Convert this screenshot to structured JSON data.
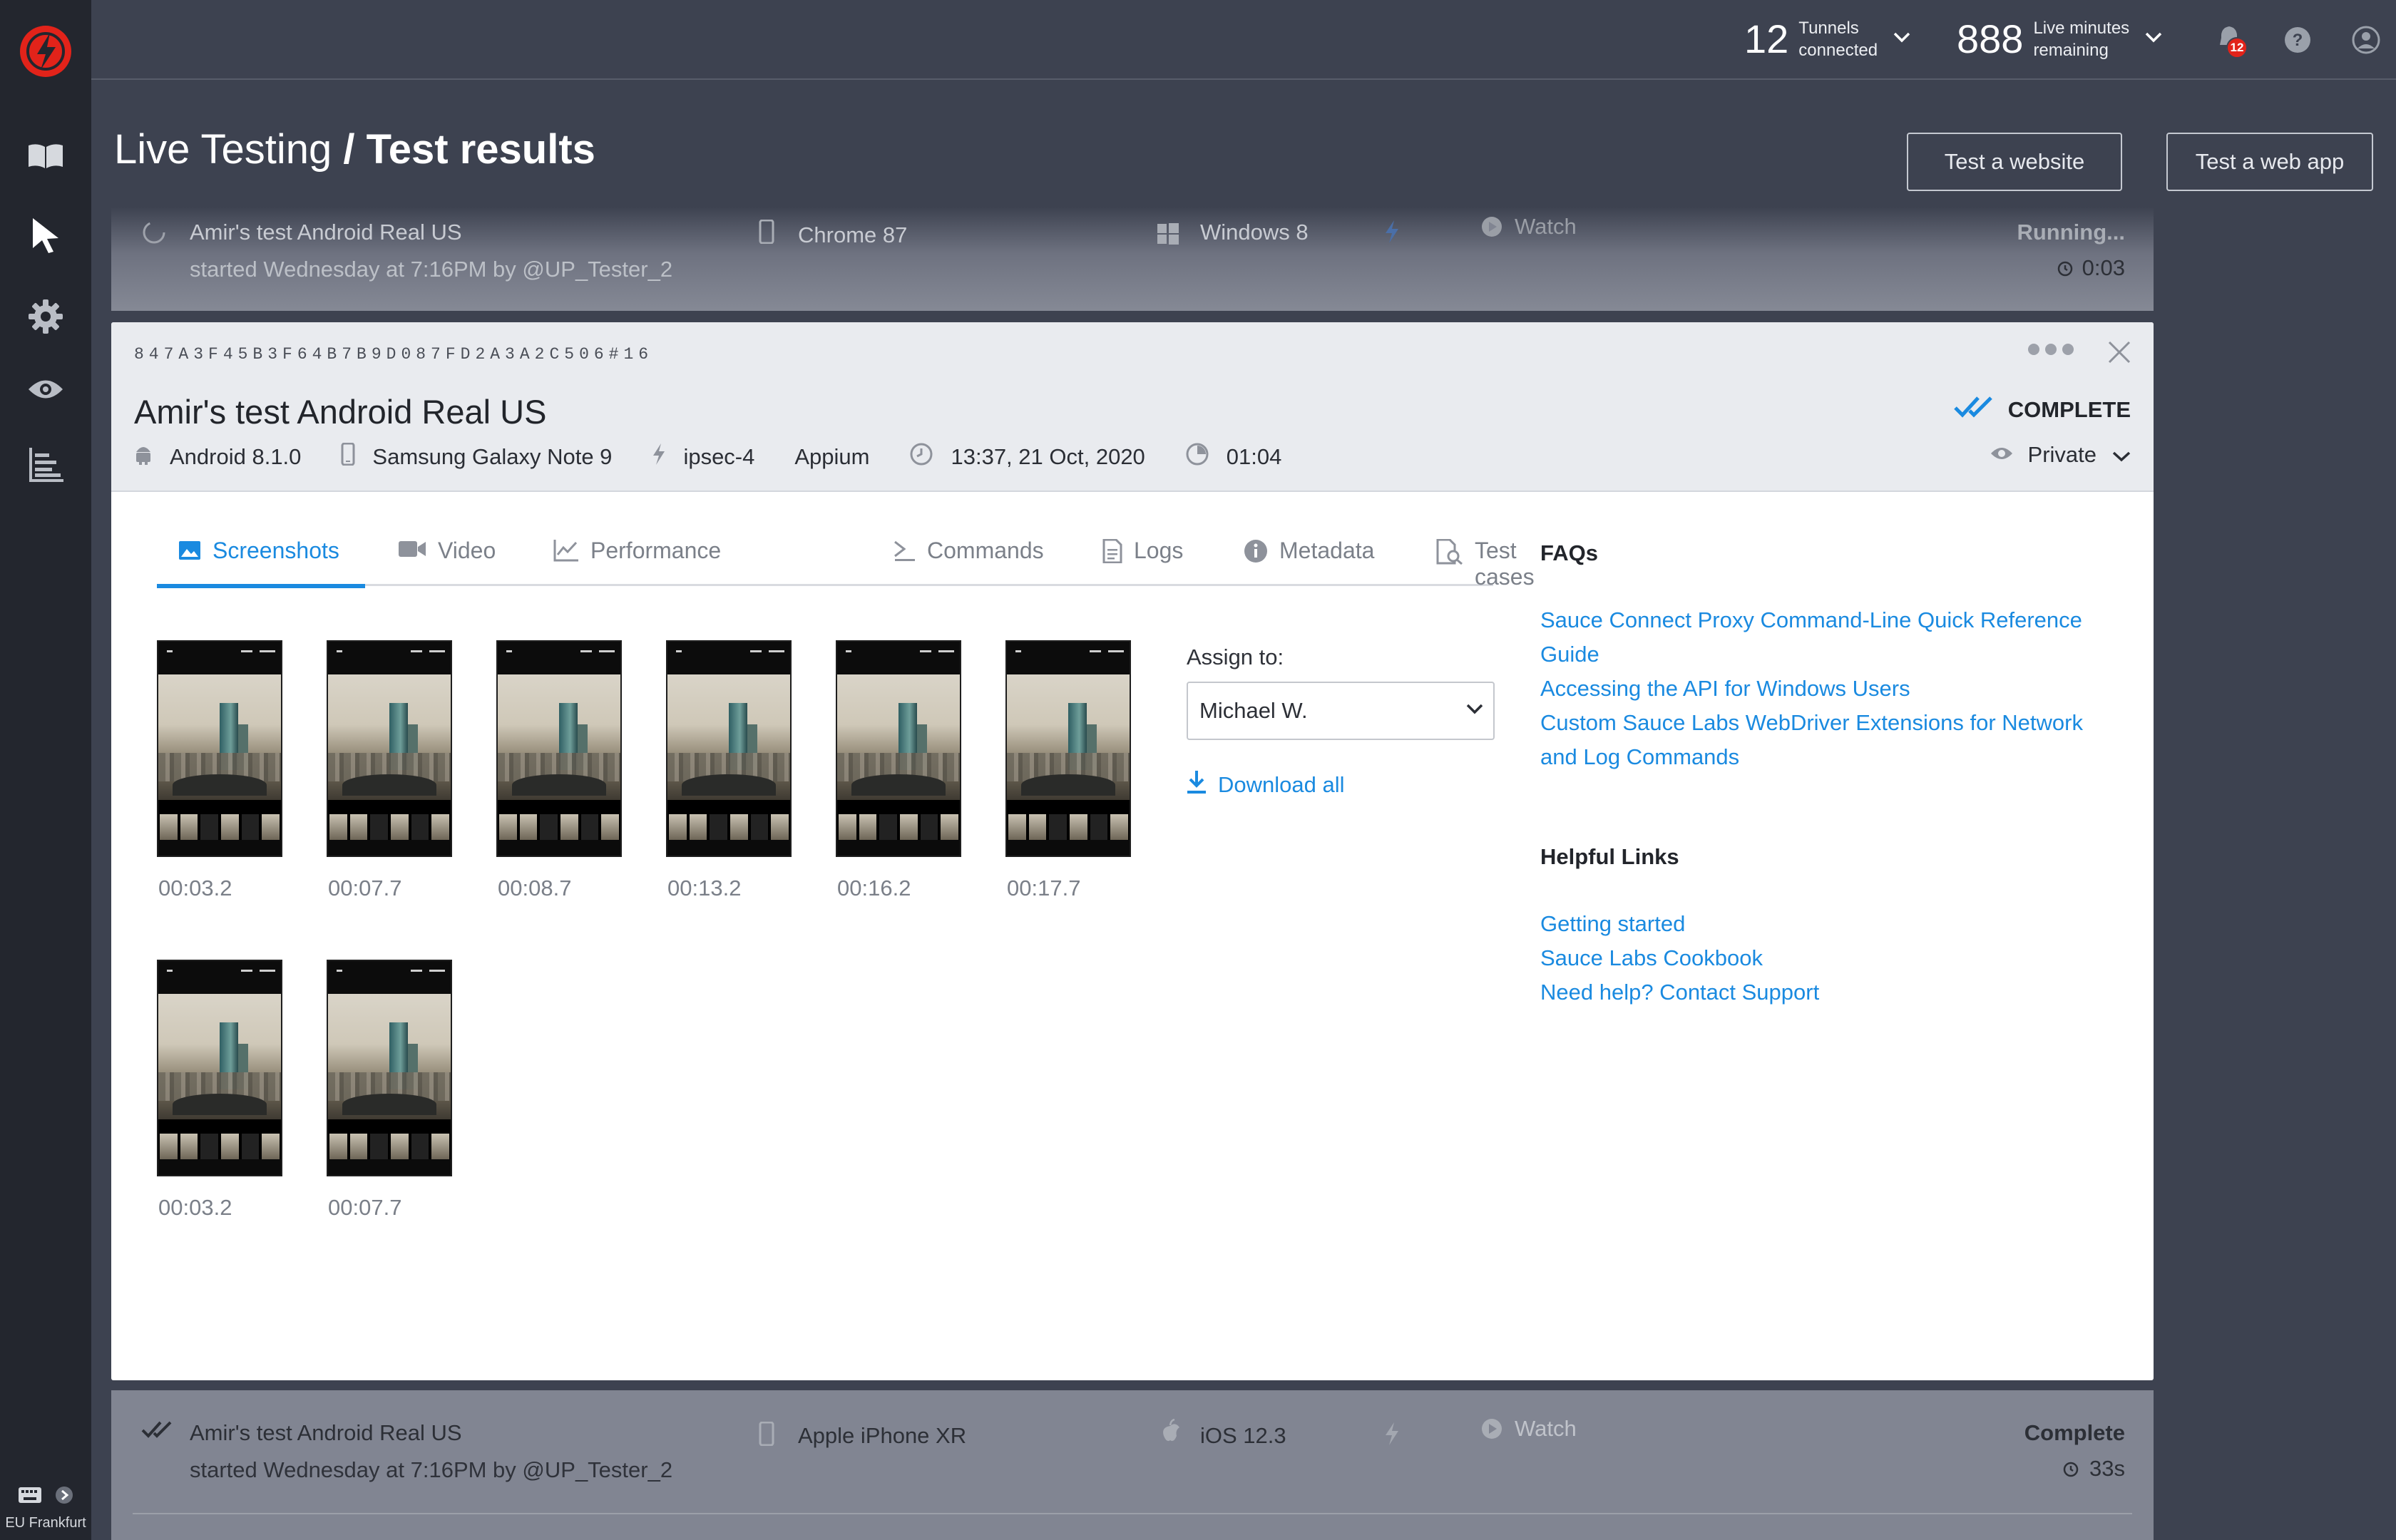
{
  "sidebar": {
    "location": "EU Frankfurt"
  },
  "topbar": {
    "tunnels": {
      "count": "12",
      "label_line1": "Tunnels",
      "label_line2": "connected"
    },
    "minutes": {
      "count": "888",
      "label_line1": "Live minutes",
      "label_line2": "remaining"
    },
    "notifications_count": "12"
  },
  "header": {
    "breadcrumb_parent": "Live Testing",
    "breadcrumb_sep": "/",
    "title": "Test results",
    "btn_website": "Test a website",
    "btn_webapp": "Test a web app"
  },
  "running_row": {
    "name": "Amir's test Android Real US",
    "started": "started Wednesday at 7:16PM by @UP_Tester_2",
    "browser": "Chrome 87",
    "os": "Windows 8",
    "watch": "Watch",
    "status": "Running...",
    "duration": "0:03"
  },
  "job": {
    "id": "847A3F45B3F64B7B9D087FD2A3A2C506#16",
    "title": "Amir's test Android Real US",
    "platform": "Android 8.1.0",
    "device": "Samsung Galaxy Note 9",
    "tunnel": "ipsec-4",
    "framework": "Appium",
    "datetime": "13:37, 21 Oct, 2020",
    "duration": "01:04",
    "status": "COMPLETE",
    "visibility": "Private"
  },
  "tabs": [
    {
      "label": "Screenshots",
      "icon": "image-icon"
    },
    {
      "label": "Video",
      "icon": "video-camera-icon"
    },
    {
      "label": "Performance",
      "icon": "line-chart-icon"
    },
    {
      "label": "Commands",
      "icon": "terminal-icon"
    },
    {
      "label": "Logs",
      "icon": "document-icon"
    },
    {
      "label": "Metadata",
      "icon": "info-icon"
    },
    {
      "label": "Test cases",
      "icon": "test-case-icon"
    }
  ],
  "screenshots": [
    {
      "time": "00:03.2"
    },
    {
      "time": "00:07.7"
    },
    {
      "time": "00:08.7"
    },
    {
      "time": "00:13.2"
    },
    {
      "time": "00:16.2"
    },
    {
      "time": "00:17.7"
    },
    {
      "time": "00:03.2"
    },
    {
      "time": "00:07.7"
    }
  ],
  "assign": {
    "label": "Assign to:",
    "value": "Michael W.",
    "download": "Download all"
  },
  "faqs": {
    "heading": "FAQs",
    "links": [
      "Sauce Connect Proxy Command-Line Quick Reference Guide",
      "Accessing the API for Windows Users",
      "Custom Sauce Labs WebDriver Extensions for Network and Log Commands"
    ]
  },
  "helpful": {
    "heading": "Helpful Links",
    "links": [
      "Getting started",
      "Sauce Labs Cookbook",
      "Need help? Contact Support"
    ]
  },
  "bottom_row": {
    "name": "Amir's test Android Real US",
    "started": "started Wednesday at 7:16PM by @UP_Tester_2",
    "device": "Apple iPhone XR",
    "os": "iOS 12.3",
    "watch": "Watch",
    "status": "Complete",
    "duration": "33s"
  },
  "colors": {
    "accent": "#1a8ae0",
    "sidebar": "#23262e",
    "page_bg": "#3d4250",
    "badge": "#e2231a"
  }
}
